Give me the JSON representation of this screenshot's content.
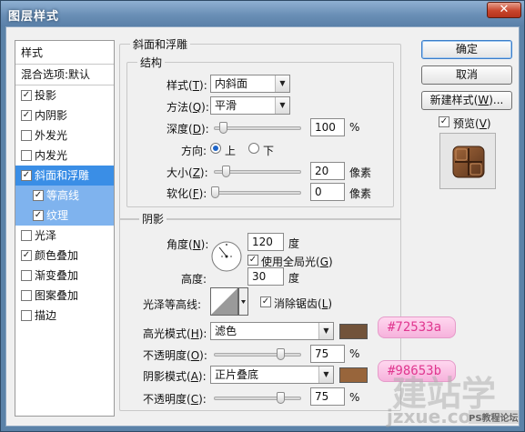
{
  "window": {
    "title": "图层样式",
    "close": "✕"
  },
  "left": {
    "header": "样式",
    "blend": "混合选项:默认",
    "items": [
      {
        "label": "投影",
        "checked": "✓"
      },
      {
        "label": "内阴影",
        "checked": "✓"
      },
      {
        "label": "外发光",
        "checked": ""
      },
      {
        "label": "内发光",
        "checked": ""
      },
      {
        "label": "斜面和浮雕",
        "checked": "✓"
      },
      {
        "label": "等高线",
        "checked": "✓"
      },
      {
        "label": "纹理",
        "checked": "✓"
      },
      {
        "label": "光泽",
        "checked": ""
      },
      {
        "label": "颜色叠加",
        "checked": "✓"
      },
      {
        "label": "渐变叠加",
        "checked": ""
      },
      {
        "label": "图案叠加",
        "checked": ""
      },
      {
        "label": "描边",
        "checked": ""
      }
    ]
  },
  "bevel": {
    "title": "斜面和浮雕",
    "structure": "结构",
    "style_label": "样式(",
    "style_key": "T",
    "style_value": "内斜面",
    "method_label": "方法(",
    "method_key": "Q",
    "method_value": "平滑",
    "depth_label": "深度(",
    "depth_key": "D",
    "depth_value": "100",
    "depth_unit": "%",
    "direction_label": "方向:",
    "dir_up": "上",
    "dir_down": "下",
    "size_label": "大小(",
    "size_key": "Z",
    "size_value": "20",
    "size_unit": "像素",
    "soften_label": "软化(",
    "soften_key": "F",
    "soften_value": "0",
    "soften_unit": "像素",
    "close_paren": "):"
  },
  "shading": {
    "title": "阴影",
    "angle_label": "角度(",
    "angle_key": "N",
    "angle_value": "120",
    "angle_unit": "度",
    "global_light": "使用全局光(",
    "global_key": "G",
    "altitude_label": "高度:",
    "altitude_value": "30",
    "altitude_unit": "度",
    "gloss_label": "光泽等高线:",
    "antialias": "消除锯齿(",
    "antialias_key": "L",
    "highlight_label": "高光模式(",
    "highlight_key": "H",
    "highlight_value": "滤色",
    "highlight_color": "#72533a",
    "opacity1_label": "不透明度(",
    "opacity1_key": "O",
    "opacity1_value": "75",
    "opacity_unit": "%",
    "shadow_label": "阴影模式(",
    "shadow_key": "A",
    "shadow_value": "正片叠底",
    "shadow_color": "#98653b",
    "opacity2_label": "不透明度(",
    "opacity2_key": "C",
    "opacity2_value": "75",
    "close_paren": "):"
  },
  "buttons": {
    "ok": "确定",
    "cancel": "取消",
    "new_style_pre": "新建样式(",
    "new_style_key": "W",
    "new_style_post": ")...",
    "preview_pre": "预览(",
    "preview_key": "V",
    "preview_post": ")"
  },
  "callouts": {
    "highlight": "#72533a",
    "shadow": "#98653b"
  },
  "watermark": {
    "cn": "建站学",
    "url": "jzxue.com",
    "site": "PS教程论坛"
  }
}
